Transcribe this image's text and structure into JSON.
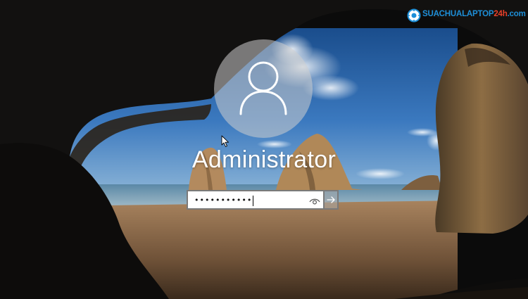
{
  "lock_screen": {
    "user": {
      "name": "Administrator",
      "avatar_icon": "user-silhouette-icon"
    },
    "password_field": {
      "masked_value": "•••••••••••",
      "reveal_icon": "eye-icon",
      "submit_icon": "arrow-right-icon"
    }
  },
  "watermark": {
    "text_main": "SUACHUALAPTOP",
    "text_accent": "24h",
    "text_suffix": ".com",
    "logo_icon": "gear-icon"
  },
  "colors": {
    "text_white": "#ffffff",
    "input_bg": "#ffffff",
    "input_border": "#7a7a7a",
    "logo_blue": "#1e8fd8",
    "logo_red": "#e8402a"
  }
}
